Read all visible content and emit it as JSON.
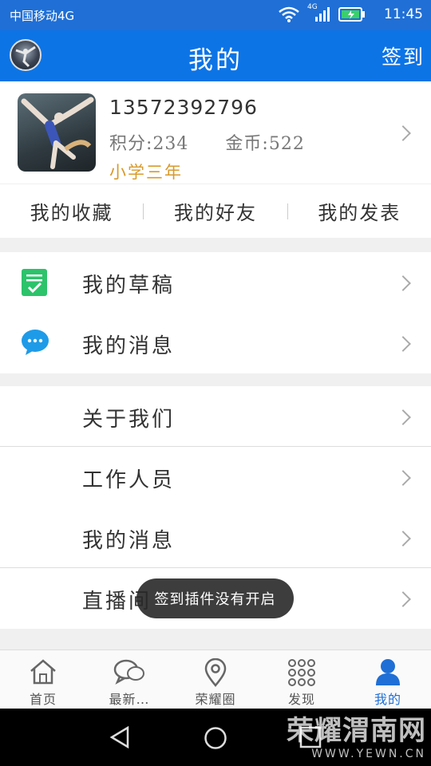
{
  "status_bar": {
    "carrier": "中国移动4G",
    "time": "11:45",
    "network": "4G"
  },
  "app_bar": {
    "title": "我的",
    "checkin_label": "签到"
  },
  "profile": {
    "phone": "13572392796",
    "points_label": "积分:234",
    "coins_label": "金币:522",
    "grade": "小学三年"
  },
  "quick_tabs": [
    "我的收藏",
    "我的好友",
    "我的发表"
  ],
  "menu_group_1": [
    {
      "label": "我的草稿",
      "icon": "draft-icon",
      "color": "#2cc36b"
    },
    {
      "label": "我的消息",
      "icon": "message-bubble-icon",
      "color": "#1e9be8"
    }
  ],
  "menu_group_2": [
    {
      "label": "关于我们"
    },
    {
      "label": "工作人员"
    },
    {
      "label": "我的消息"
    },
    {
      "label": "直播间"
    }
  ],
  "toast": "签到插件没有开启",
  "bottom_nav": [
    {
      "label": "首页",
      "icon": "home-icon"
    },
    {
      "label": "最新…",
      "icon": "chat-bubbles-icon"
    },
    {
      "label": "荣耀圈",
      "icon": "location-pin-icon"
    },
    {
      "label": "发现",
      "icon": "grid-dots-icon"
    },
    {
      "label": "我的",
      "icon": "person-icon",
      "active": true
    }
  ],
  "watermark": {
    "main": "荣耀渭南网",
    "sub": "WWW.YEWN.CN"
  },
  "colors": {
    "primary": "#0d74e6",
    "status_bar": "#1f6fd6",
    "grade": "#d89a2a"
  }
}
